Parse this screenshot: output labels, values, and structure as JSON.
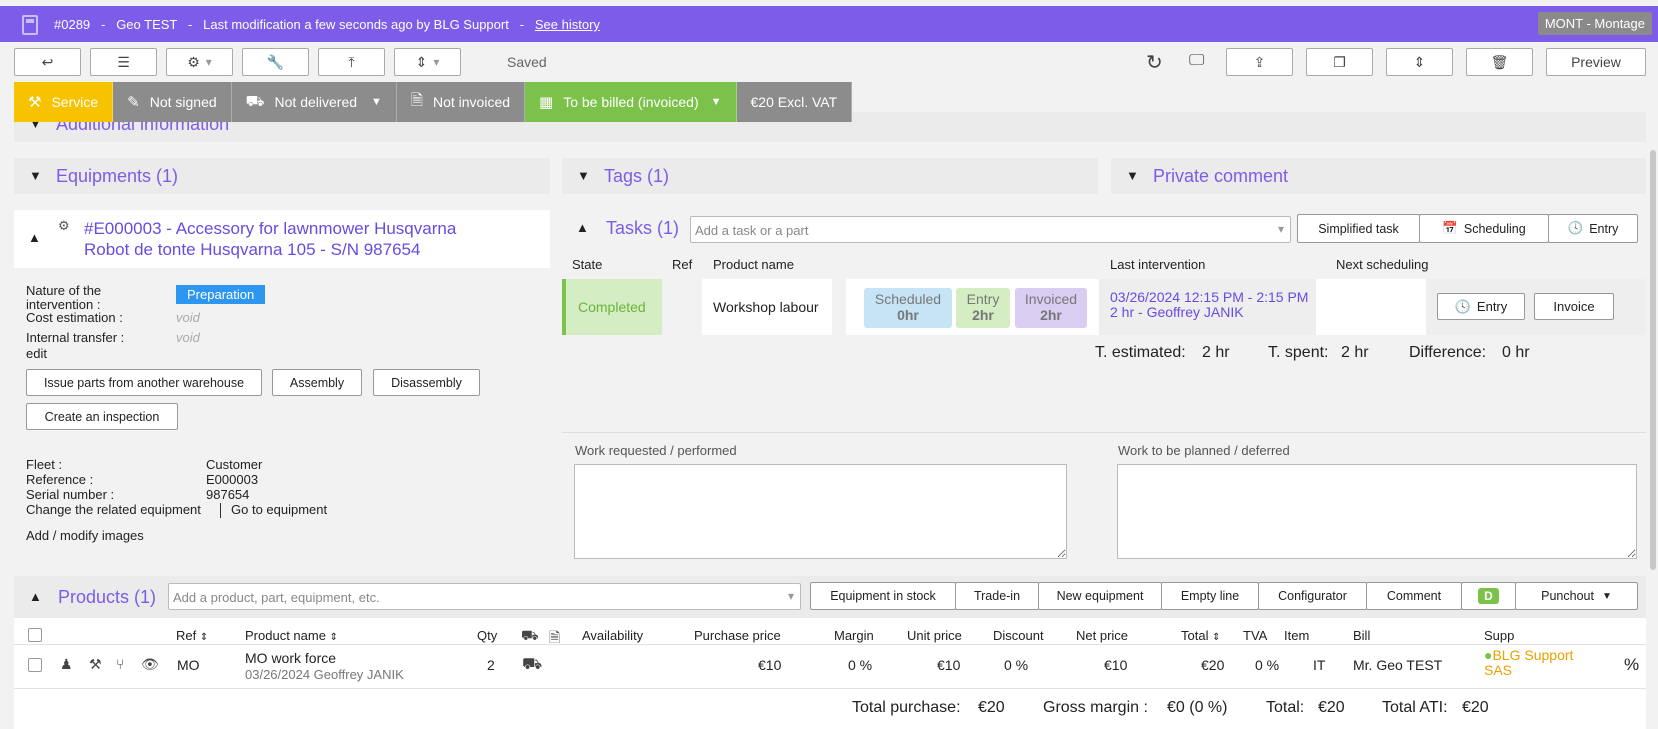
{
  "header": {
    "id": "#0289",
    "sep1": "-",
    "name": "Geo TEST",
    "sep2": "-",
    "modification": "Last modification a few seconds ago by BLG Support",
    "sep3": "-",
    "history_link": "See history",
    "badge": "MONT - Montage"
  },
  "toolbar": {
    "saved": "Saved",
    "preview": "Preview"
  },
  "statusbar": {
    "service": "Service",
    "not_signed": "Not signed",
    "not_delivered": "Not delivered",
    "not_invoiced": "Not invoiced",
    "to_be_billed": "To be billed (invoiced)",
    "amount": "€20 Excl. VAT",
    "colors": {
      "service": "#f7c200",
      "grey": "#8c8c8c",
      "green": "#7cc24a"
    }
  },
  "sections": {
    "additional_info": "Additional information",
    "equipments": "Equipments (1)",
    "tags": "Tags (1)",
    "private_comment": "Private comment"
  },
  "equipment": {
    "title_line1": "#E000003 - Accessory for lawnmower Husqvarna",
    "title_line2": "Robot de tonte Husqvarna 105 - S/N 987654",
    "nature_label": "Nature of the intervention :",
    "nature_value": "Preparation",
    "cost_label": "Cost estimation :",
    "cost_value": "void",
    "transfer_label": "Internal transfer :",
    "transfer_value": "void",
    "edit": "edit",
    "btn_issue": "Issue parts from another warehouse",
    "btn_assembly": "Assembly",
    "btn_disassembly": "Disassembly",
    "btn_inspection": "Create an inspection",
    "fleet_label": "Fleet :",
    "fleet_value": "Customer",
    "ref_label": "Reference :",
    "ref_value": "E000003",
    "serial_label": "Serial number :",
    "serial_value": "987654",
    "change_link": "Change the related equipment",
    "goto_link": "Go to equipment",
    "images_link": "Add / modify images"
  },
  "tasks": {
    "title": "Tasks (1)",
    "placeholder": "Add a task or a part",
    "btn_simplified": "Simplified task",
    "btn_scheduling": "Scheduling",
    "btn_entry": "Entry",
    "col_state": "State",
    "col_ref": "Ref",
    "col_product": "Product name",
    "col_last": "Last intervention",
    "col_next": "Next scheduling",
    "row": {
      "state": "Completed",
      "product": "Workshop labour",
      "scheduled_label": "Scheduled",
      "scheduled_value": "0hr",
      "entry_label": "Entry",
      "entry_value": "2hr",
      "invoiced_label": "Invoiced",
      "invoiced_value": "2hr",
      "last_line1": "03/26/2024 12:15 PM - 2:15 PM",
      "last_line2": "2 hr - Geoffrey JANIK",
      "btn_entry": "Entry",
      "btn_invoice": "Invoice"
    },
    "t_estimated_label": "T. estimated:",
    "t_estimated_value": "2 hr",
    "t_spent_label": "T. spent:",
    "t_spent_value": "2 hr",
    "difference_label": "Difference:",
    "difference_value": "0 hr",
    "work_requested": "Work requested / performed",
    "work_planned": "Work to be planned / deferred"
  },
  "products": {
    "title": "Products (1)",
    "placeholder": "Add a product, part, equipment, etc.",
    "buttons": [
      "Equipment in stock",
      "Trade-in",
      "New equipment",
      "Empty line",
      "Configurator",
      "Comment"
    ],
    "d_badge": "D",
    "punchout": "Punchout",
    "cols": {
      "ref": "Ref",
      "product": "Product name",
      "qty": "Qty",
      "availability": "Availability",
      "purchase": "Purchase price",
      "margin": "Margin",
      "unit": "Unit price",
      "discount": "Discount",
      "net": "Net price",
      "total": "Total",
      "tva": "TVA",
      "item": "Item",
      "bill": "Bill",
      "supp": "Supp"
    },
    "row": {
      "ref": "MO",
      "product": "MO work force",
      "sub": "03/26/2024 Geoffrey JANIK",
      "qty": "2",
      "purchase": "€10",
      "margin": "0 %",
      "unit": "€10",
      "discount": "0 %",
      "net": "€10",
      "total": "€20",
      "tva": "0 %",
      "item": "IT",
      "bill": "Mr. Geo TEST",
      "supp_line1": "BLG Support",
      "supp_line2": "SAS",
      "pct": "%"
    },
    "totals": {
      "purchase_label": "Total purchase:",
      "purchase_value": "€20",
      "margin_label": "Gross margin :",
      "margin_value": "€0 (0 %)",
      "total_label": "Total:",
      "total_value": "€20",
      "ati_label": "Total ATI:",
      "ati_value": "€20"
    }
  }
}
